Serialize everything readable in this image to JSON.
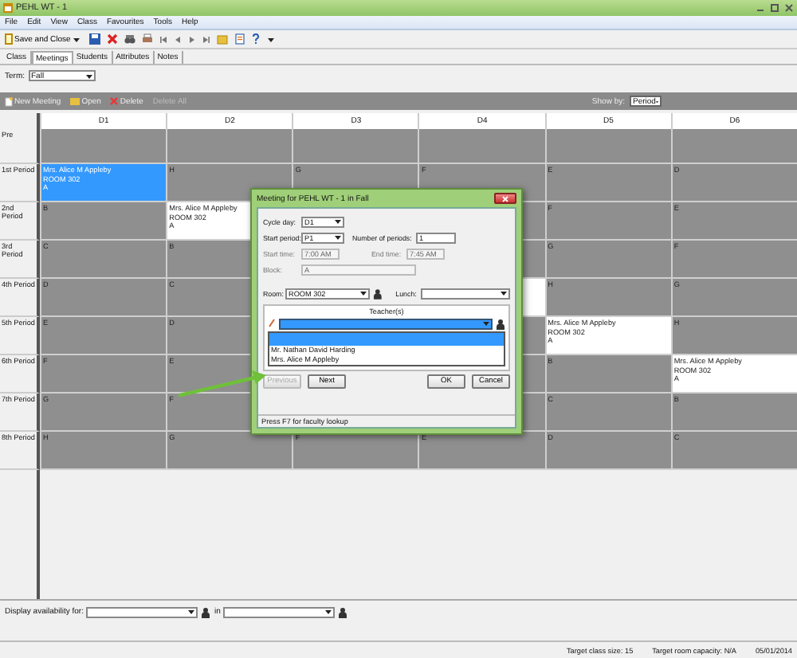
{
  "window": {
    "title": "PEHL WT - 1"
  },
  "menu": [
    "File",
    "Edit",
    "View",
    "Class",
    "Favourites",
    "Tools",
    "Help"
  ],
  "toolbar": {
    "save_button": "Save and Close"
  },
  "tabs": [
    {
      "label": "Class",
      "selected": false
    },
    {
      "label": "Meetings",
      "selected": true
    },
    {
      "label": "Students",
      "selected": false
    },
    {
      "label": "Attributes",
      "selected": false
    },
    {
      "label": "Notes",
      "selected": false
    }
  ],
  "term": {
    "label": "Term:",
    "value": "Fall"
  },
  "actions": [
    {
      "kind": "new",
      "label": "New Meeting",
      "disabled": false
    },
    {
      "kind": "open",
      "label": "Open",
      "disabled": false
    },
    {
      "kind": "delete",
      "label": "Delete",
      "disabled": false
    },
    {
      "kind": "plain",
      "label": "Delete All",
      "disabled": true
    }
  ],
  "show_by": {
    "label": "Show by:",
    "value": "Period"
  },
  "grid": {
    "columns": [
      "D1",
      "D2",
      "D3",
      "D4",
      "D5",
      "D6"
    ],
    "rows": [
      {
        "label": "Pre",
        "cells": [
          {
            "kind": "empty"
          },
          {
            "kind": "empty"
          },
          {
            "kind": "empty"
          },
          {
            "kind": "empty"
          },
          {
            "kind": "empty"
          },
          {
            "kind": "empty"
          }
        ]
      },
      {
        "label": "1st Period",
        "cells": [
          {
            "kind": "meeting",
            "lines": [
              "Mrs. Alice M Appleby",
              "ROOM 302",
              "A"
            ],
            "selected": true
          },
          {
            "kind": "letter",
            "text": "H"
          },
          {
            "kind": "letter",
            "text": "G"
          },
          {
            "kind": "letter",
            "text": "F"
          },
          {
            "kind": "letter",
            "text": "E"
          },
          {
            "kind": "letter",
            "text": "D"
          }
        ]
      },
      {
        "label": "2nd Period",
        "cells": [
          {
            "kind": "letter",
            "text": "B"
          },
          {
            "kind": "meeting",
            "lines": [
              "Mrs. Alice M Appleby",
              "ROOM 302",
              "A"
            ],
            "selected": false
          },
          {
            "kind": "covered"
          },
          {
            "kind": "empty"
          },
          {
            "kind": "letter",
            "text": "F"
          },
          {
            "kind": "letter",
            "text": "E"
          }
        ]
      },
      {
        "label": "3rd Period",
        "cells": [
          {
            "kind": "letter",
            "text": "C"
          },
          {
            "kind": "letter",
            "text": "B"
          },
          {
            "kind": "covered"
          },
          {
            "kind": "empty"
          },
          {
            "kind": "letter",
            "text": "G"
          },
          {
            "kind": "letter",
            "text": "F"
          }
        ]
      },
      {
        "label": "4th Period",
        "cells": [
          {
            "kind": "letter",
            "text": "D"
          },
          {
            "kind": "letter",
            "text": "C"
          },
          {
            "kind": "covered"
          },
          {
            "kind": "meeting",
            "selected": false
          },
          {
            "kind": "letter",
            "text": "H"
          },
          {
            "kind": "letter",
            "text": "G"
          }
        ]
      },
      {
        "label": "5th Period",
        "cells": [
          {
            "kind": "letter",
            "text": "E"
          },
          {
            "kind": "letter",
            "text": "D"
          },
          {
            "kind": "covered"
          },
          {
            "kind": "empty"
          },
          {
            "kind": "meeting",
            "lines": [
              "Mrs. Alice M Appleby",
              "ROOM 302",
              "A"
            ],
            "selected": false
          },
          {
            "kind": "letter",
            "text": "H"
          }
        ]
      },
      {
        "label": "6th Period",
        "cells": [
          {
            "kind": "letter",
            "text": "F"
          },
          {
            "kind": "letter",
            "text": "E"
          },
          {
            "kind": "empty"
          },
          {
            "kind": "empty"
          },
          {
            "kind": "letter",
            "text": "B"
          },
          {
            "kind": "meeting",
            "lines": [
              "Mrs. Alice M Appleby",
              "ROOM 302",
              "A"
            ],
            "selected": false
          }
        ]
      },
      {
        "label": "7th Period",
        "cells": [
          {
            "kind": "letter",
            "text": "G"
          },
          {
            "kind": "letter",
            "text": "F"
          },
          {
            "kind": "empty"
          },
          {
            "kind": "empty"
          },
          {
            "kind": "letter",
            "text": "C"
          },
          {
            "kind": "letter",
            "text": "B"
          }
        ]
      },
      {
        "label": "8th Period",
        "cells": [
          {
            "kind": "letter",
            "text": "H"
          },
          {
            "kind": "letter",
            "text": "G"
          },
          {
            "kind": "letter",
            "text": "F"
          },
          {
            "kind": "letter",
            "text": "E"
          },
          {
            "kind": "letter",
            "text": "D"
          },
          {
            "kind": "letter",
            "text": "C"
          }
        ]
      }
    ]
  },
  "dialog": {
    "title": "Meeting for PEHL WT - 1 in Fall",
    "cycle_day": {
      "label": "Cycle day:",
      "value": "D1"
    },
    "start_period": {
      "label": "Start period:",
      "value": "P1"
    },
    "number_of_periods": {
      "label": "Number of periods:",
      "value": "1"
    },
    "start_time": {
      "label": "Start time:",
      "value": "7:00 AM",
      "disabled": true
    },
    "end_time": {
      "label": "End time:",
      "value": "7:45 AM",
      "disabled": true
    },
    "block": {
      "label": "Block:",
      "value": "A",
      "disabled": true
    },
    "room": {
      "label": "Room:",
      "value": "ROOM 302"
    },
    "lunch": {
      "label": "Lunch:"
    },
    "teachers": {
      "header": "Teacher(s)",
      "blank_selected": true,
      "options": [
        "Mr. Nathan David Harding",
        "Mrs. Alice M Appleby"
      ]
    },
    "buttons": [
      {
        "label": "Previous",
        "disabled": true
      },
      {
        "label": "Next",
        "disabled": false
      },
      {
        "label": "OK",
        "disabled": false
      },
      {
        "label": "Cancel",
        "disabled": false
      }
    ],
    "hint": "Press F7 for faculty lookup"
  },
  "availability": {
    "label": "Display availability for:",
    "connector": "in"
  },
  "status_bar": [
    "Target class size: 15",
    "Target room capacity: N/A",
    "05/01/2014"
  ]
}
